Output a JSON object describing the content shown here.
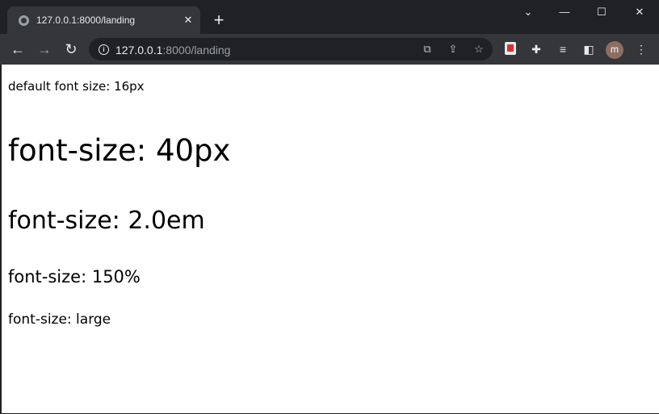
{
  "tab": {
    "title": "127.0.0.1:8000/landing"
  },
  "address": {
    "host": "127.0.0.1",
    "rest": ":8000/landing"
  },
  "avatar": {
    "letter": "m"
  },
  "page": {
    "default_text": "default font size: 16px",
    "px40_text": "font-size: 40px",
    "em2_text": "font-size: 2.0em",
    "pct150_text": "font-size: 150%",
    "large_text": "font-size: large"
  },
  "icons": {
    "tab_favicon": "globe-icon",
    "tab_close": "close-icon",
    "new_tab": "plus-icon",
    "chevron": "chevron-down-icon",
    "minimize": "minimize-icon",
    "maximize": "maximize-icon",
    "close_window": "close-icon",
    "back": "arrow-left-icon",
    "forward": "arrow-right-icon",
    "reload": "reload-icon",
    "site_info": "info-icon",
    "translate": "translate-icon",
    "share": "share-icon",
    "bookmark": "star-icon",
    "extension": "extension-icon",
    "puzzle": "puzzle-icon",
    "reading_list": "reading-list-icon",
    "side_panel": "side-panel-icon",
    "menu": "more-vert-icon"
  },
  "colors": {
    "frame": "#202124",
    "toolbar": "#35363a",
    "page": "#ffffff",
    "text_light": "#e8eaed"
  }
}
